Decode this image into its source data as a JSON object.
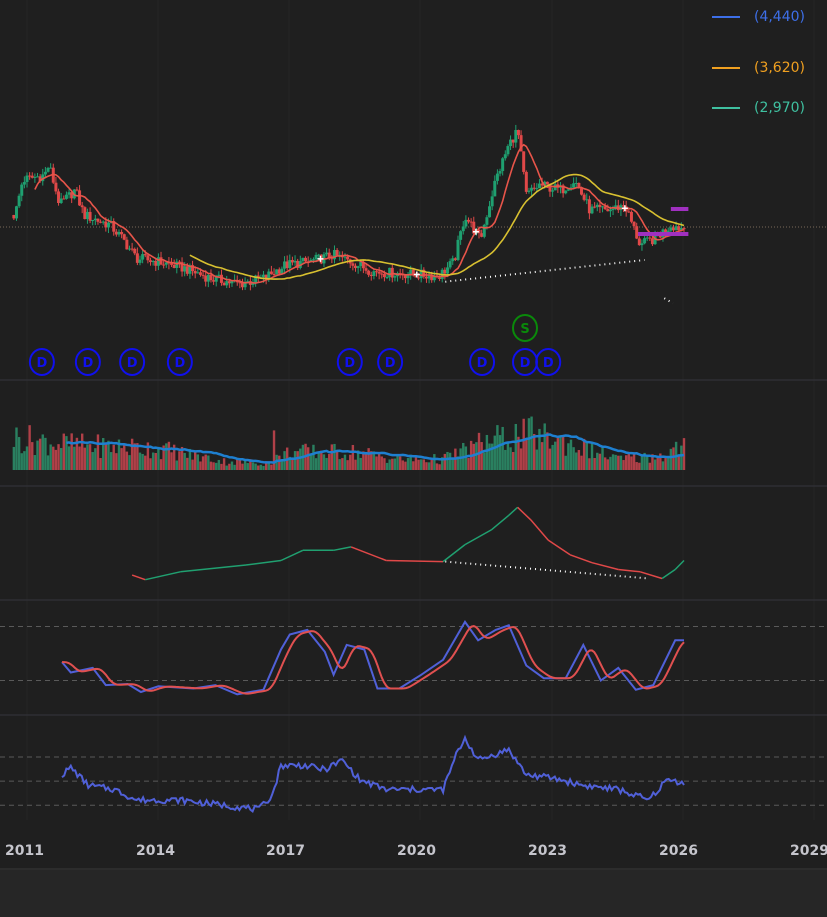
{
  "legend": [
    {
      "label": "(4,440)",
      "color": "#3d6fe8"
    },
    {
      "label": "(3,620)",
      "color": "#f0a020"
    },
    {
      "label": "(2,970)",
      "color": "#3fc0a0"
    }
  ],
  "chart_data": {
    "type": "candlestick",
    "x_axis": {
      "ticks": [
        "2011",
        "2014",
        "2017",
        "2020",
        "2023",
        "2026",
        "2029"
      ],
      "range": [
        2010.7,
        2029.5
      ]
    },
    "reference_price": 4440,
    "price_keypoints": [
      [
        2010.73,
        4800
      ],
      [
        2010.9,
        5850
      ],
      [
        2011.4,
        6000
      ],
      [
        2011.5,
        6300
      ],
      [
        2011.75,
        5100
      ],
      [
        2012.1,
        5550
      ],
      [
        2012.3,
        4800
      ],
      [
        2012.9,
        4500
      ],
      [
        2013.2,
        4050
      ],
      [
        2013.5,
        3500
      ],
      [
        2014.0,
        3400
      ],
      [
        2014.6,
        3200
      ],
      [
        2015.2,
        2900
      ],
      [
        2015.85,
        2730
      ],
      [
        2016.4,
        2900
      ],
      [
        2016.9,
        3300
      ],
      [
        2017.45,
        3400
      ],
      [
        2018.0,
        3600
      ],
      [
        2018.4,
        3400
      ],
      [
        2018.9,
        3100
      ],
      [
        2019.7,
        3030
      ],
      [
        2020.4,
        2970
      ],
      [
        2020.75,
        3400
      ],
      [
        2021.0,
        4800
      ],
      [
        2021.35,
        4050
      ],
      [
        2021.7,
        5850
      ],
      [
        2022.0,
        6900
      ],
      [
        2022.2,
        7350
      ],
      [
        2022.4,
        5400
      ],
      [
        2022.7,
        5700
      ],
      [
        2023.2,
        5550
      ],
      [
        2023.5,
        5850
      ],
      [
        2023.85,
        4950
      ],
      [
        2024.3,
        4950
      ],
      [
        2024.65,
        5100
      ],
      [
        2025.0,
        3900
      ],
      [
        2025.35,
        4100
      ],
      [
        2025.7,
        4500
      ],
      [
        2026.0,
        4400
      ]
    ],
    "moving_averages": [
      {
        "name": "fast",
        "color": "#e8554a",
        "window": 8
      },
      {
        "name": "slow",
        "color": "#d8c030",
        "window": 30,
        "start": 2014.7
      }
    ],
    "levels": [
      {
        "value": 4980,
        "from": 2025.7,
        "to": 2026.1,
        "color": "#a030c0"
      },
      {
        "value": 4230,
        "from": 2024.95,
        "to": 2026.1,
        "color": "#a030c0"
      }
    ],
    "trendline": {
      "from": [
        2020.55,
        2800
      ],
      "to": [
        2025.1,
        3450
      ]
    },
    "cross_markers": [
      2017.7,
      2019.9,
      2021.25,
      2024.65
    ],
    "events": [
      {
        "label": "D",
        "year": 2011.34
      },
      {
        "label": "D",
        "year": 2012.39
      },
      {
        "label": "D",
        "year": 2013.4
      },
      {
        "label": "D",
        "year": 2014.49
      },
      {
        "label": "D",
        "year": 2018.37
      },
      {
        "label": "D",
        "year": 2019.29
      },
      {
        "label": "D",
        "year": 2021.39
      },
      {
        "label": "D",
        "year": 2022.37
      },
      {
        "label": "D",
        "year": 2022.9
      },
      {
        "label": "S",
        "year": 2022.37
      }
    ],
    "volume_keypoints": [
      [
        2010.7,
        45
      ],
      [
        2012.0,
        35
      ],
      [
        2014.0,
        30
      ],
      [
        2015.5,
        12
      ],
      [
        2016.5,
        10
      ],
      [
        2017.0,
        25
      ],
      [
        2018.5,
        25
      ],
      [
        2019.5,
        15
      ],
      [
        2020.5,
        15
      ],
      [
        2021.5,
        40
      ],
      [
        2022.5,
        50
      ],
      [
        2023.5,
        35
      ],
      [
        2024.5,
        15
      ],
      [
        2025.5,
        20
      ],
      [
        2026.0,
        35
      ]
    ],
    "volume_spikes": [
      [
        2016.62,
        100
      ],
      [
        2016.66,
        55
      ],
      [
        2022.55,
        50
      ]
    ],
    "indicator1": [
      [
        2013.4,
        22
      ],
      [
        2013.7,
        18
      ],
      [
        2014.5,
        25
      ],
      [
        2016.0,
        31
      ],
      [
        2016.8,
        35
      ],
      [
        2017.3,
        44
      ],
      [
        2018.0,
        44
      ],
      [
        2018.4,
        47
      ],
      [
        2019.2,
        35
      ],
      [
        2020.5,
        34
      ],
      [
        2021.0,
        49
      ],
      [
        2021.6,
        62
      ],
      [
        2022.0,
        75
      ],
      [
        2022.2,
        82
      ],
      [
        2022.5,
        71
      ],
      [
        2022.9,
        53
      ],
      [
        2023.4,
        40
      ],
      [
        2023.9,
        33
      ],
      [
        2024.5,
        27
      ],
      [
        2025.0,
        25
      ],
      [
        2025.5,
        19
      ],
      [
        2025.8,
        27
      ],
      [
        2026.0,
        35
      ]
    ],
    "indicator1_trendline": {
      "from": [
        2020.55,
        34
      ],
      "to": [
        2025.2,
        19
      ]
    },
    "oscillator": {
      "levels": [
        77,
        30
      ],
      "series": [
        [
          2011.8,
          46
        ],
        [
          2012.0,
          37
        ],
        [
          2012.5,
          41
        ],
        [
          2012.8,
          26
        ],
        [
          2013.3,
          27
        ],
        [
          2013.6,
          20
        ],
        [
          2014.0,
          25
        ],
        [
          2014.8,
          23
        ],
        [
          2015.3,
          26
        ],
        [
          2015.8,
          18
        ],
        [
          2016.4,
          22
        ],
        [
          2016.8,
          57
        ],
        [
          2017.0,
          70
        ],
        [
          2017.4,
          74
        ],
        [
          2017.8,
          55
        ],
        [
          2018.0,
          35
        ],
        [
          2018.3,
          61
        ],
        [
          2018.7,
          57
        ],
        [
          2019.0,
          23
        ],
        [
          2019.5,
          23
        ],
        [
          2020.0,
          35
        ],
        [
          2020.5,
          48
        ],
        [
          2021.0,
          81
        ],
        [
          2021.3,
          65
        ],
        [
          2021.7,
          74
        ],
        [
          2022.0,
          78
        ],
        [
          2022.4,
          43
        ],
        [
          2022.8,
          32
        ],
        [
          2023.3,
          32
        ],
        [
          2023.7,
          61
        ],
        [
          2024.1,
          30
        ],
        [
          2024.5,
          41
        ],
        [
          2024.9,
          22
        ],
        [
          2025.3,
          26
        ],
        [
          2025.8,
          65
        ],
        [
          2026.0,
          65
        ]
      ]
    },
    "indicator3": {
      "levels": [
        60,
        37,
        14
      ],
      "series": [
        [
          2011.8,
          43
        ],
        [
          2012.0,
          50
        ],
        [
          2012.4,
          33
        ],
        [
          2013.0,
          29
        ],
        [
          2013.5,
          19
        ],
        [
          2014.5,
          19
        ],
        [
          2015.5,
          14
        ],
        [
          2016.3,
          10
        ],
        [
          2016.6,
          24
        ],
        [
          2016.8,
          52
        ],
        [
          2017.3,
          52
        ],
        [
          2017.8,
          48
        ],
        [
          2018.2,
          57
        ],
        [
          2018.6,
          38
        ],
        [
          2019.2,
          29
        ],
        [
          2020.5,
          29
        ],
        [
          2020.8,
          62
        ],
        [
          2021.0,
          78
        ],
        [
          2021.3,
          57
        ],
        [
          2022.0,
          67
        ],
        [
          2022.4,
          43
        ],
        [
          2023.0,
          40
        ],
        [
          2023.7,
          33
        ],
        [
          2024.5,
          29
        ],
        [
          2025.2,
          19
        ],
        [
          2025.6,
          38
        ],
        [
          2026.0,
          36
        ]
      ]
    }
  }
}
